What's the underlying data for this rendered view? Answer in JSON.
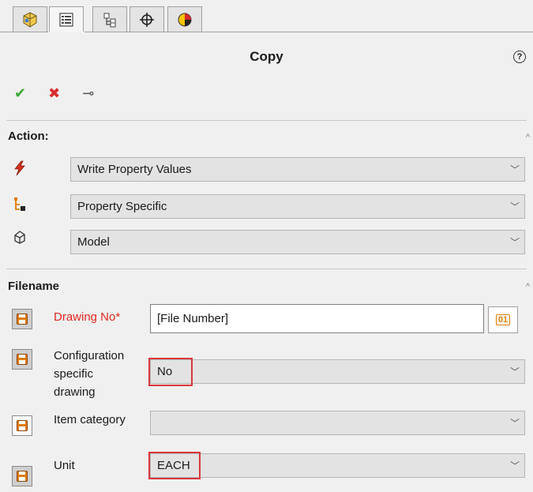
{
  "tabs": [
    {
      "icon": "feature-tree-icon",
      "active": false
    },
    {
      "icon": "property-manager-icon",
      "active": true
    },
    {
      "icon": "configuration-manager-icon",
      "active": false
    },
    {
      "icon": "dimxpert-icon",
      "active": false
    },
    {
      "icon": "display-manager-icon",
      "active": false
    }
  ],
  "header": {
    "title": "Copy",
    "help_glyph": "?"
  },
  "toolbar": {
    "ok_glyph": "✔",
    "cancel_glyph": "✖",
    "pin_glyph": "⊸"
  },
  "action": {
    "title": "Action:",
    "rows": [
      {
        "icon": "lightning-icon",
        "value": "Write Property Values"
      },
      {
        "icon": "property-tree-icon",
        "value": "Property Specific"
      },
      {
        "icon": "model-icon",
        "value": "Model"
      }
    ]
  },
  "filename": {
    "title": "Filename",
    "drawing_no": {
      "label": "Drawing No*",
      "value": "[File Number]",
      "number_button": "01"
    },
    "config_specific": {
      "label_lines": [
        "Configuration",
        "specific",
        "drawing"
      ],
      "value": "No"
    },
    "item_category": {
      "label": "Item category",
      "value": ""
    },
    "unit": {
      "label": "Unit",
      "value": "EACH"
    }
  },
  "colors": {
    "ok": "#3aa535",
    "cancel": "#d92b2b",
    "required": "#e0281d",
    "highlight": "#d9383a",
    "accent_orange": "#e07b00"
  }
}
